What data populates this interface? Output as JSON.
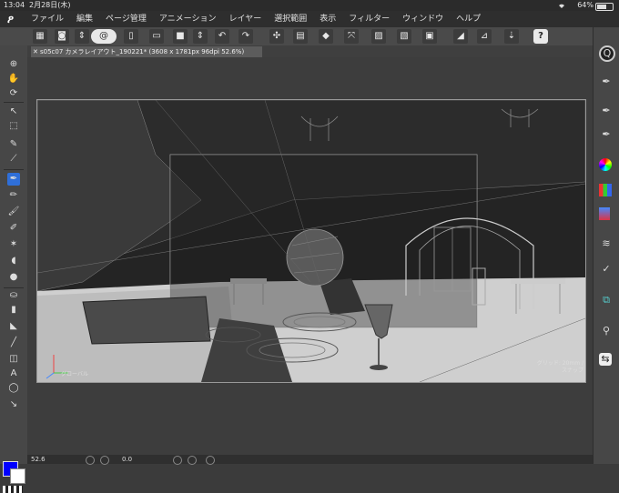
{
  "status": {
    "time": "13:04",
    "date": "2月28日(木)",
    "battery": "64%"
  },
  "menu": [
    "ファイル",
    "編集",
    "ページ管理",
    "アニメーション",
    "レイヤー",
    "選択範囲",
    "表示",
    "フィルター",
    "ウィンドウ",
    "ヘルプ"
  ],
  "document_tab": {
    "title": "s05c07 カメラレイアウト_190221* (3608 x 1781px 96dpi 52.6%)"
  },
  "canvas": {
    "grid_label": "グリッド: 20mm /",
    "snap_label": "スナップ",
    "global_label": "グローバル"
  },
  "bottom": {
    "zoom": "52.6",
    "rotation": "0.0"
  },
  "colors": {
    "main": "#0000ff",
    "sub": "#ffffff"
  },
  "icons": {
    "toolbar": [
      "grid-icon",
      "camera-icon",
      "up-down-arrows-icon",
      "spiral-icon",
      "new-page-icon",
      "open-folder-icon",
      "canvas-frame-icon",
      "undo-icon",
      "redo-icon",
      "clear-icon",
      "fill-icon",
      "eraser-icon",
      "transform-icon",
      "select-icon",
      "selection-icon",
      "ruler-icon",
      "perspective-ruler-icon",
      "pen-pressure-icon",
      "help-icon"
    ],
    "left": [
      "zoom-icon",
      "hand-icon",
      "rotate-icon",
      "operation-icon",
      "selection-marquee-icon",
      "eyedropper-icon",
      "pen-icon",
      "pencil-icon",
      "brush-icon",
      "airbrush-icon",
      "decoration-icon",
      "eraser-icon",
      "blend-icon",
      "fill-icon",
      "gradient-icon",
      "figure-icon",
      "frame-border-icon",
      "ruler-tool-icon",
      "text-icon",
      "balloon-icon",
      "correct-line-icon"
    ],
    "right": [
      "navigator-icon",
      "sub-tool-icon",
      "tool-property-icon",
      "brush-size-icon",
      "color-wheel-icon",
      "color-set-icon",
      "intermediate-color-icon",
      "layer-icon",
      "layer-property-icon",
      "material-icon",
      "auto-action-icon",
      "sync-icon"
    ]
  }
}
